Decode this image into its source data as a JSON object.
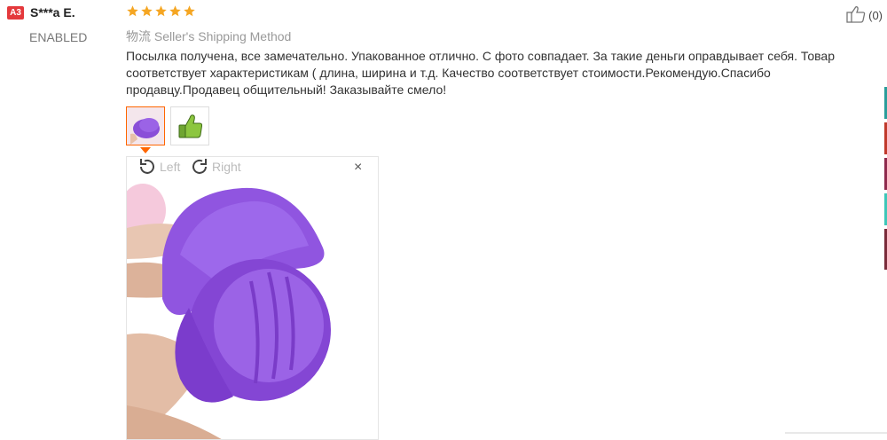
{
  "reviewer": {
    "country_code": "A3",
    "name": "S***a E.",
    "status": "ENABLED"
  },
  "rating": {
    "stars": 5,
    "max": 5,
    "color": "#f5a623"
  },
  "helpful": {
    "count": "(0)"
  },
  "shipping": {
    "prefix": "物流",
    "method": "Seller's Shipping Method"
  },
  "review_text": "Посылка получена, все замечательно. Упакованное отлично. С фото совпадает. За такие деньги оправдывает себя. Товар соответствует характеристикам ( длина, ширина и т.д. Качество соответствует стоимости.Рекомендую.Спасибо продавцу.Продавец общительный! Заказывайте смело!",
  "thumbnails": [
    {
      "icon": "purple-oven-mitt-thumbnail",
      "active": true
    },
    {
      "icon": "thumbs-up-icon",
      "active": false
    }
  ],
  "viewer": {
    "rotate_left_label": "Left",
    "rotate_right_label": "Right",
    "close_label": "×"
  },
  "colors": {
    "accent": "#f60",
    "badge": "#e4393c",
    "product": "#8a4fd8"
  }
}
